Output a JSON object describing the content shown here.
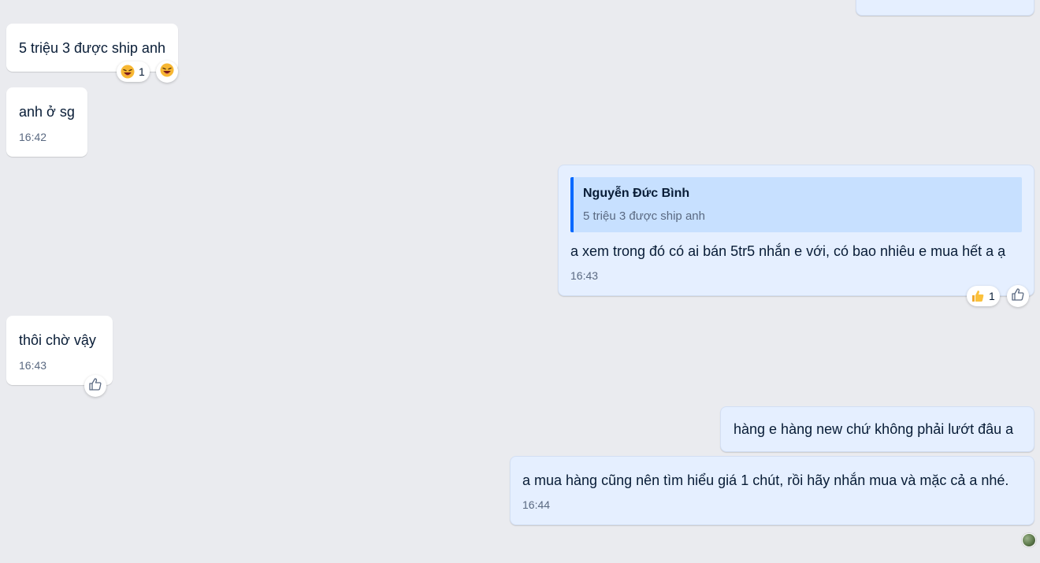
{
  "conversation": {
    "messages": [
      {
        "id": "m1",
        "direction": "in",
        "text": "5 triệu 3 được ship anh",
        "time": "",
        "reaction": {
          "emoji": "laughing",
          "count": "1"
        }
      },
      {
        "id": "m2",
        "direction": "in",
        "text": "anh ở sg",
        "time": "16:42"
      },
      {
        "id": "m3",
        "direction": "out",
        "text": "a xem trong đó có ai bán 5tr5 nhắn e với, có bao nhiêu e mua hết a ạ",
        "time": "16:43",
        "quote": {
          "author": "Nguyễn Đức Bình",
          "text": "5 triệu 3 được ship anh"
        },
        "reaction": {
          "emoji": "thumbs-up",
          "count": "1"
        }
      },
      {
        "id": "m4",
        "direction": "in",
        "text": "thôi chờ vậy",
        "time": "16:43"
      },
      {
        "id": "m5",
        "direction": "out",
        "text": "hàng e hàng new chứ không phải lướt đâu a",
        "time": ""
      },
      {
        "id": "m6",
        "direction": "out",
        "text": "a mua hàng cũng nên tìm hiểu giá 1 chút, rồi hãy nhắn mua và mặc cả a nhé.",
        "time": "16:44"
      }
    ]
  },
  "colors": {
    "background": "#eaebef",
    "incoming_bubble": "#ffffff",
    "outgoing_bubble": "#e5efff",
    "quote_background": "#c7e0ff",
    "quote_accent": "#0068ff",
    "timestamp": "#5a6981"
  },
  "icons": {
    "reaction_laugh": "laughing-face-icon",
    "reaction_like": "thumbs-up-icon",
    "add_reaction": "like-outline-icon",
    "seen_avatar": "avatar"
  }
}
